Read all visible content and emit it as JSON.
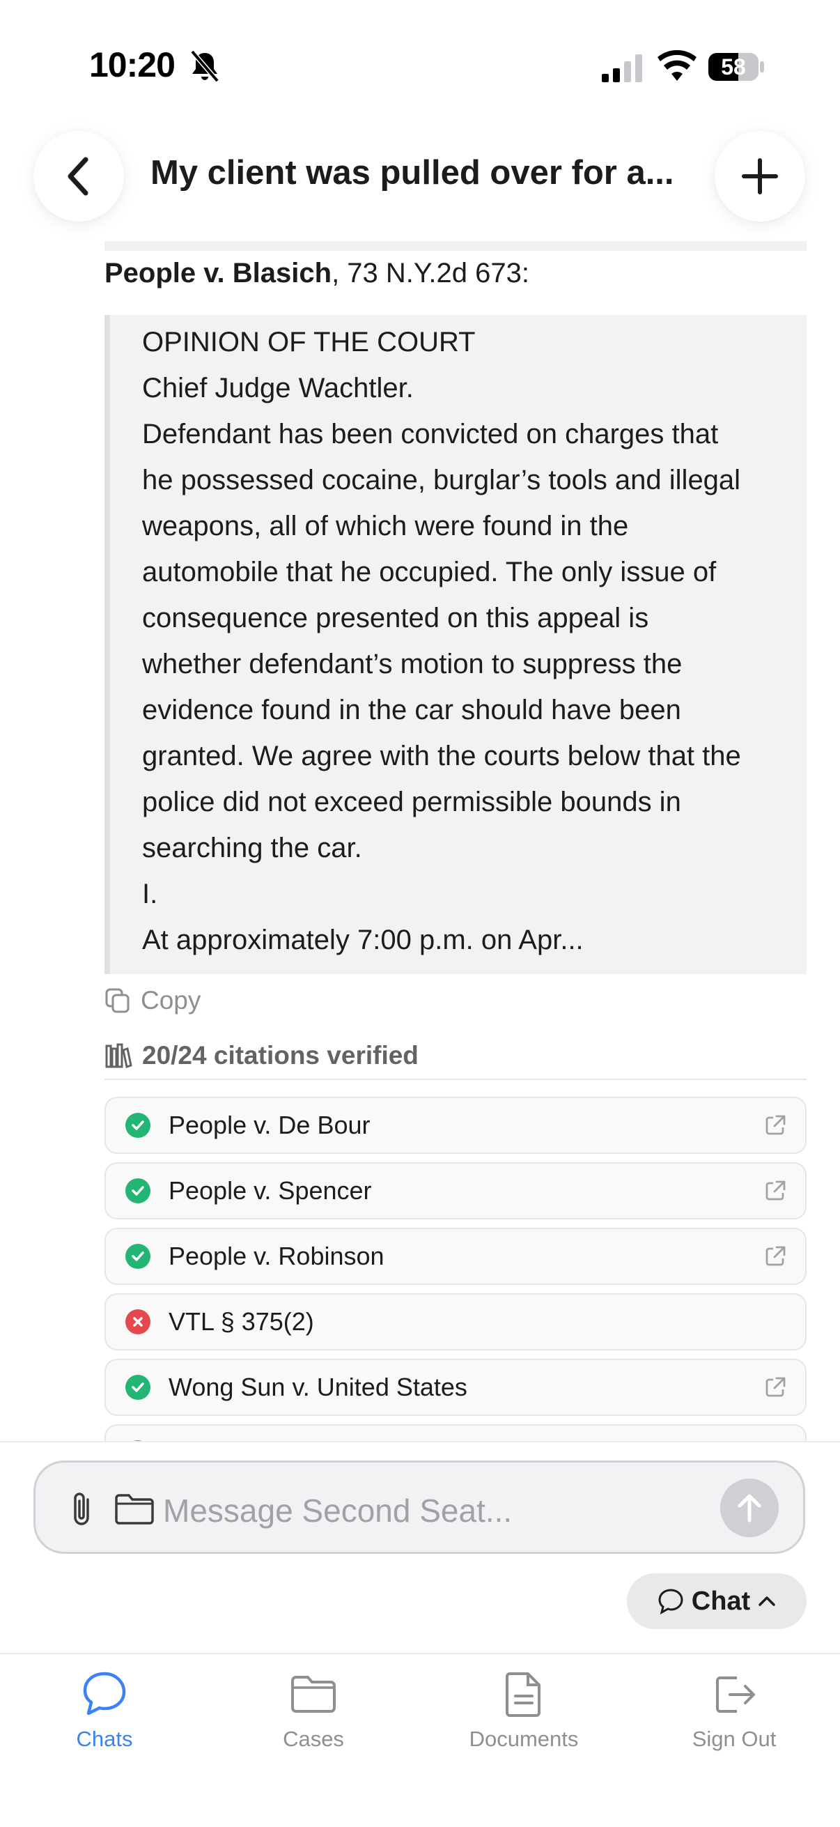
{
  "status_bar": {
    "time": "10:20",
    "battery": "58"
  },
  "header": {
    "title": "My client was pulled over for a..."
  },
  "case": {
    "name": "People v. Blasich",
    "citation": ", 73 N.Y.2d 673:",
    "quote_lines": [
      "OPINION OF THE COURT",
      "Chief Judge Wachtler.",
      "Defendant has been convicted on charges that",
      "he possessed cocaine, burglar’s tools and illegal",
      "weapons, all of which were found in the",
      "automobile that he occupied. The only issue of",
      "consequence presented on this appeal is",
      "whether defendant’s motion to suppress the",
      "evidence found in the car should have been",
      "granted. We agree with the courts below that the",
      "police did not exceed permissible bounds in",
      "searching the car.",
      "I.",
      "At approximately 7:00 p.m. on Apr..."
    ]
  },
  "actions": {
    "copy_label": "Copy"
  },
  "citations": {
    "summary": "20/24 citations verified",
    "items": [
      {
        "name": "People v. De Bour",
        "verified": true,
        "link": true
      },
      {
        "name": "People v. Spencer",
        "verified": true,
        "link": true
      },
      {
        "name": "People v. Robinson",
        "verified": true,
        "link": true
      },
      {
        "name": "VTL § 375(2)",
        "verified": false,
        "link": false
      },
      {
        "name": "Wong Sun v. United States",
        "verified": true,
        "link": true
      },
      {
        "name": "",
        "verified": true,
        "link": false
      }
    ]
  },
  "composer": {
    "placeholder": "Message Second Seat...",
    "mode_label": "Chat"
  },
  "tabs": [
    {
      "label": "Chats",
      "icon": "chat-bubble-icon",
      "active": true
    },
    {
      "label": "Cases",
      "icon": "folder-icon",
      "active": false
    },
    {
      "label": "Documents",
      "icon": "document-icon",
      "active": false
    },
    {
      "label": "Sign Out",
      "icon": "sign-out-icon",
      "active": false
    }
  ],
  "colors": {
    "accent": "#3b82f6",
    "verified": "#22b573",
    "unverified": "#e5484d"
  }
}
